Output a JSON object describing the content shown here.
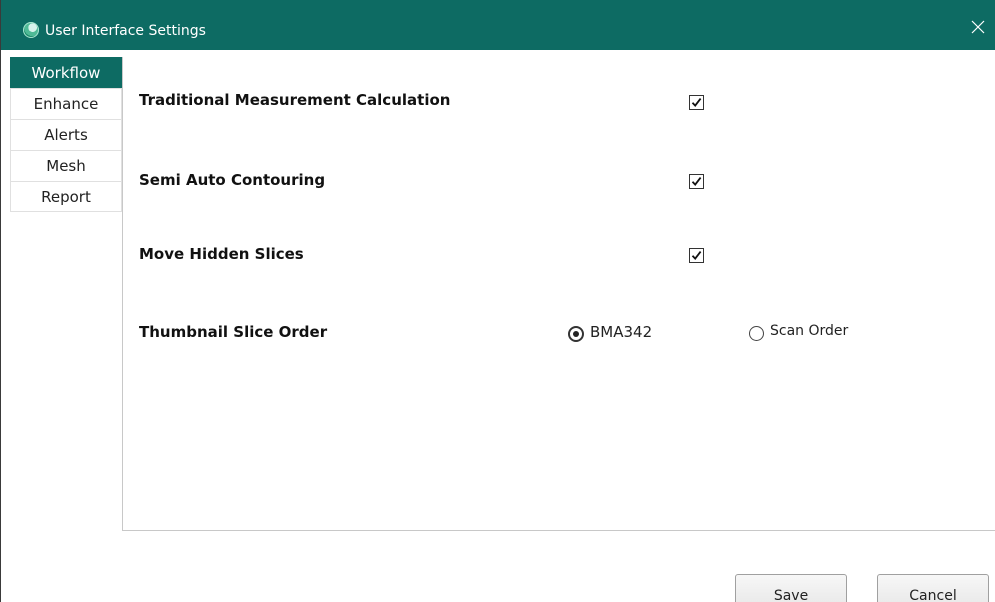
{
  "window": {
    "title": "User Interface Settings",
    "accent_color": "#0d6b63",
    "app_icon": "app-logo-icon",
    "close_icon": "close-icon"
  },
  "tabs": [
    {
      "label": "Workflow",
      "active": true
    },
    {
      "label": "Enhance",
      "active": false
    },
    {
      "label": "Alerts",
      "active": false
    },
    {
      "label": "Mesh",
      "active": false
    },
    {
      "label": "Report",
      "active": false
    }
  ],
  "settings": {
    "traditional_measurement": {
      "label": "Traditional Measurement Calculation",
      "checked": true
    },
    "semi_auto_contouring": {
      "label": "Semi Auto Contouring",
      "checked": true
    },
    "move_hidden_slices": {
      "label": "Move Hidden Slices",
      "checked": true
    },
    "thumbnail_slice_order": {
      "label": "Thumbnail Slice Order",
      "options": [
        {
          "label": "BMA342",
          "selected": true
        },
        {
          "label": "Scan Order",
          "selected": false
        }
      ]
    }
  },
  "buttons": {
    "save_label": "Save",
    "cancel_label": "Cancel"
  }
}
